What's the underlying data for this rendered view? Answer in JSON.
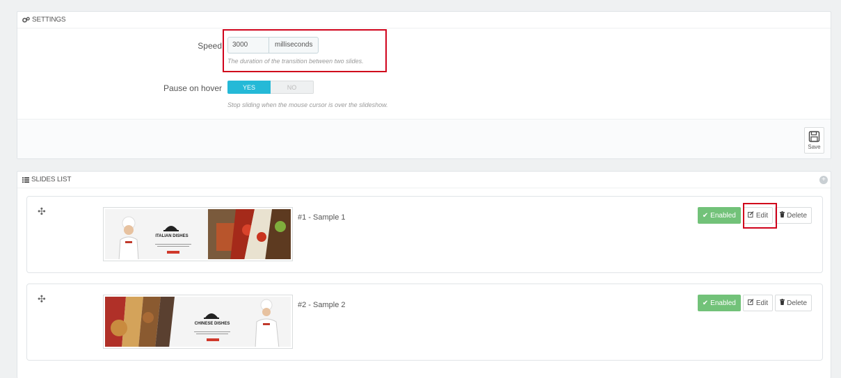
{
  "settings": {
    "title": "SETTINGS",
    "speed_label": "Speed",
    "speed_value": "3000",
    "speed_unit": "milliseconds",
    "speed_help": "The duration of the transition between two slides.",
    "pause_label": "Pause on hover",
    "pause_yes": "YES",
    "pause_no": "NO",
    "pause_help": "Stop sliding when the mouse cursor is over the slideshow.",
    "save_label": "Save"
  },
  "slides_list": {
    "title": "SLIDES LIST",
    "items": [
      {
        "label": "#1 - Sample 1",
        "thumb_title": "ITALIAN DISHES",
        "enabled_label": "Enabled",
        "edit_label": "Edit",
        "delete_label": "Delete"
      },
      {
        "label": "#2 - Sample 2",
        "thumb_title": "CHINESE DISHES",
        "enabled_label": "Enabled",
        "edit_label": "Edit",
        "delete_label": "Delete"
      }
    ]
  },
  "colors": {
    "accent": "#25b9d7",
    "enabled": "#72c279",
    "highlight": "#d0021b"
  }
}
